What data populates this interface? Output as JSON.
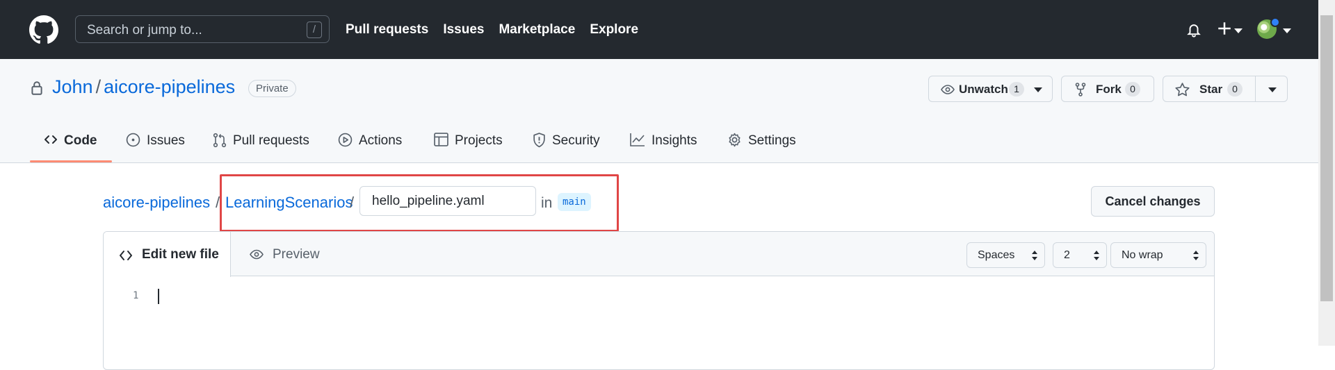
{
  "header": {
    "search_placeholder": "Search or jump to...",
    "search_shortcut": "/",
    "nav": [
      "Pull requests",
      "Issues",
      "Marketplace",
      "Explore"
    ]
  },
  "repo": {
    "owner": "John",
    "separator": "/",
    "name": "aicore-pipelines",
    "visibility": "Private",
    "watch": {
      "label": "Unwatch",
      "count": "1"
    },
    "fork": {
      "label": "Fork",
      "count": "0"
    },
    "star": {
      "label": "Star",
      "count": "0"
    }
  },
  "tabs": [
    {
      "label": "Code",
      "icon": "code-icon",
      "active": true
    },
    {
      "label": "Issues",
      "icon": "issue-icon"
    },
    {
      "label": "Pull requests",
      "icon": "pull-request-icon"
    },
    {
      "label": "Actions",
      "icon": "play-icon"
    },
    {
      "label": "Projects",
      "icon": "table-icon"
    },
    {
      "label": "Security",
      "icon": "shield-icon"
    },
    {
      "label": "Insights",
      "icon": "graph-icon"
    },
    {
      "label": "Settings",
      "icon": "gear-icon"
    }
  ],
  "file_path": {
    "repo": "aicore-pipelines",
    "sep": "/",
    "folder": "LearningScenarios",
    "filename": "hello_pipeline.yaml",
    "in_label": "in",
    "branch": "main"
  },
  "cancel_label": "Cancel changes",
  "editor": {
    "edit_tab": "Edit new file",
    "preview_tab": "Preview",
    "indent_mode": "Spaces",
    "indent_size": "2",
    "wrap_mode": "No wrap",
    "line_number": "1"
  },
  "colors": {
    "header_bg": "#24292f",
    "link": "#0969da",
    "active_tab_underline": "#fd8c73",
    "highlight_box": "#e04646"
  }
}
